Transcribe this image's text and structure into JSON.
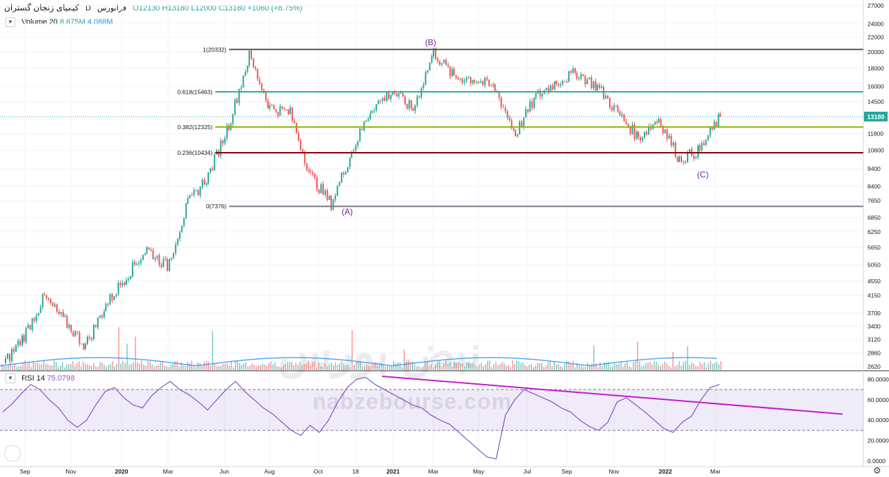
{
  "header": {
    "symbol": "کیمیای زنجان گستران",
    "interval": "D",
    "exchange": "فرابورس",
    "open": "O12130",
    "high": "H13180",
    "low": "L12000",
    "close": "C13180",
    "change": "+1060 (+8.75%)"
  },
  "volume_legend": {
    "label": "Volume 20",
    "v1": "8.675M",
    "v2": "4.088M"
  },
  "rsi_legend": {
    "label": "RSI 14",
    "value": "75.0798"
  },
  "watermark": {
    "site": "nabzebourse.com",
    "brand": "نبض بورس"
  },
  "colors": {
    "up": "#26a69a",
    "down": "#ef5350",
    "fib0": "#787b86",
    "fib236": "#8b0000",
    "fib382": "#8db600",
    "fib618": "#22ab94",
    "fib1": "#555555",
    "rsi": "#7e57c2",
    "trendline": "#c21bd0",
    "wave": "#7b1fa2"
  },
  "chart_data": [
    {
      "type": "candlestick",
      "title": "کیمیای زنجان گستران",
      "price_axis_ticks": [
        27000,
        24000,
        22000,
        20000,
        18000,
        16000,
        14500,
        13000,
        11800,
        10600,
        9400,
        8400,
        7650,
        6850,
        6250,
        5650,
        5050,
        4550,
        4150,
        3700,
        3400,
        3120,
        2860,
        2620
      ],
      "y_scale": "log",
      "ylim": [
        2560,
        28000
      ],
      "time_axis_ticks": [
        "Sep",
        "Nov",
        "2020",
        "Mar",
        "Jun",
        "Aug",
        "Oct",
        "18",
        "2021",
        "Mar",
        "May",
        "Jul",
        "Sep",
        "Nov",
        "2022",
        "Mar"
      ],
      "last_price": "13180",
      "fibonacci": [
        {
          "label": "1(20332)",
          "level": 1,
          "price": 20332
        },
        {
          "label": "0.618(15463)",
          "level": 0.618,
          "price": 15463
        },
        {
          "label": "0.382(12325)",
          "level": 0.382,
          "price": 12325
        },
        {
          "label": "0.236(10434)",
          "level": 0.236,
          "price": 10434
        },
        {
          "label": "0(7376)",
          "level": 0,
          "price": 7376
        }
      ],
      "wave_labels": [
        {
          "label": "(B)",
          "date_index": 0.468,
          "price": 20900
        },
        {
          "label": "(A)",
          "date_index": 0.385,
          "price": 7000
        },
        {
          "label": "(C)",
          "date_index": 0.79,
          "price": 8900
        }
      ],
      "price_path": [
        [
          "Aug 2019",
          2650
        ],
        [
          "Sep 2019",
          3200
        ],
        [
          "Oct 2019",
          4100
        ],
        [
          "Nov 2019",
          3500
        ],
        [
          "Dec 2019",
          3000
        ],
        [
          "Jan 2020",
          3900
        ],
        [
          "Feb 2020",
          4700
        ],
        [
          "Mar 2020",
          5600
        ],
        [
          "Apr 2020",
          5000
        ],
        [
          "May 2020",
          7500
        ],
        [
          "May 2020",
          9000
        ],
        [
          "Jun 2020",
          12500
        ],
        [
          "Jul 2020",
          19500
        ],
        [
          "Aug 2020",
          14000
        ],
        [
          "Sep 2020",
          13500
        ],
        [
          "Oct 2020",
          9000
        ],
        [
          "Nov 2020",
          7500
        ],
        [
          "Dec 2020",
          10500
        ],
        [
          "Jan 2021",
          14000
        ],
        [
          "Feb 2021",
          15500
        ],
        [
          "Feb 2021",
          13800
        ],
        [
          "Mar 2021",
          20000
        ],
        [
          "Apr 2021",
          17000
        ],
        [
          "May 2021",
          16800
        ],
        [
          "Jun 2021",
          15800
        ],
        [
          "Jul 2021",
          11800
        ],
        [
          "Jul 2021",
          15000
        ],
        [
          "Aug 2021",
          16500
        ],
        [
          "Sep 2021",
          17500
        ],
        [
          "Oct 2021",
          16000
        ],
        [
          "Nov 2021",
          13500
        ],
        [
          "Dec 2021",
          11500
        ],
        [
          "Jan 2022",
          13000
        ],
        [
          "Feb 2022",
          10000
        ],
        [
          "Feb 2022",
          10600
        ],
        [
          "Mar 2022",
          13180
        ]
      ]
    },
    {
      "type": "bar",
      "title": "Volume 20",
      "values": [
        8.675,
        4.088
      ]
    },
    {
      "type": "line",
      "title": "RSI 14",
      "last_value": 75.0798,
      "ylim": [
        0,
        85
      ],
      "y_ticks": [
        "80.0000",
        "60.0000",
        "40.0000",
        "20.0000",
        "0.0000"
      ],
      "bands": [
        30,
        70
      ],
      "series": [
        {
          "name": "RSI 14",
          "values": [
            48,
            56,
            66,
            75,
            70,
            60,
            52,
            40,
            33,
            40,
            55,
            68,
            72,
            62,
            55,
            52,
            64,
            72,
            78,
            70,
            65,
            58,
            50,
            60,
            70,
            78,
            68,
            60,
            52,
            46,
            38,
            30,
            25,
            35,
            28,
            40,
            58,
            72,
            80,
            82,
            75,
            70,
            65,
            60,
            55,
            52,
            45,
            40,
            36,
            28,
            20,
            12,
            4,
            2,
            45,
            60,
            70,
            66,
            62,
            58,
            52,
            48,
            40,
            34,
            30,
            38,
            58,
            62,
            55,
            48,
            40,
            32,
            28,
            38,
            44,
            60,
            72,
            75
          ]
        }
      ],
      "trendline": [
        [
          0.43,
          83
        ],
        [
          0.95,
          46
        ]
      ]
    }
  ]
}
